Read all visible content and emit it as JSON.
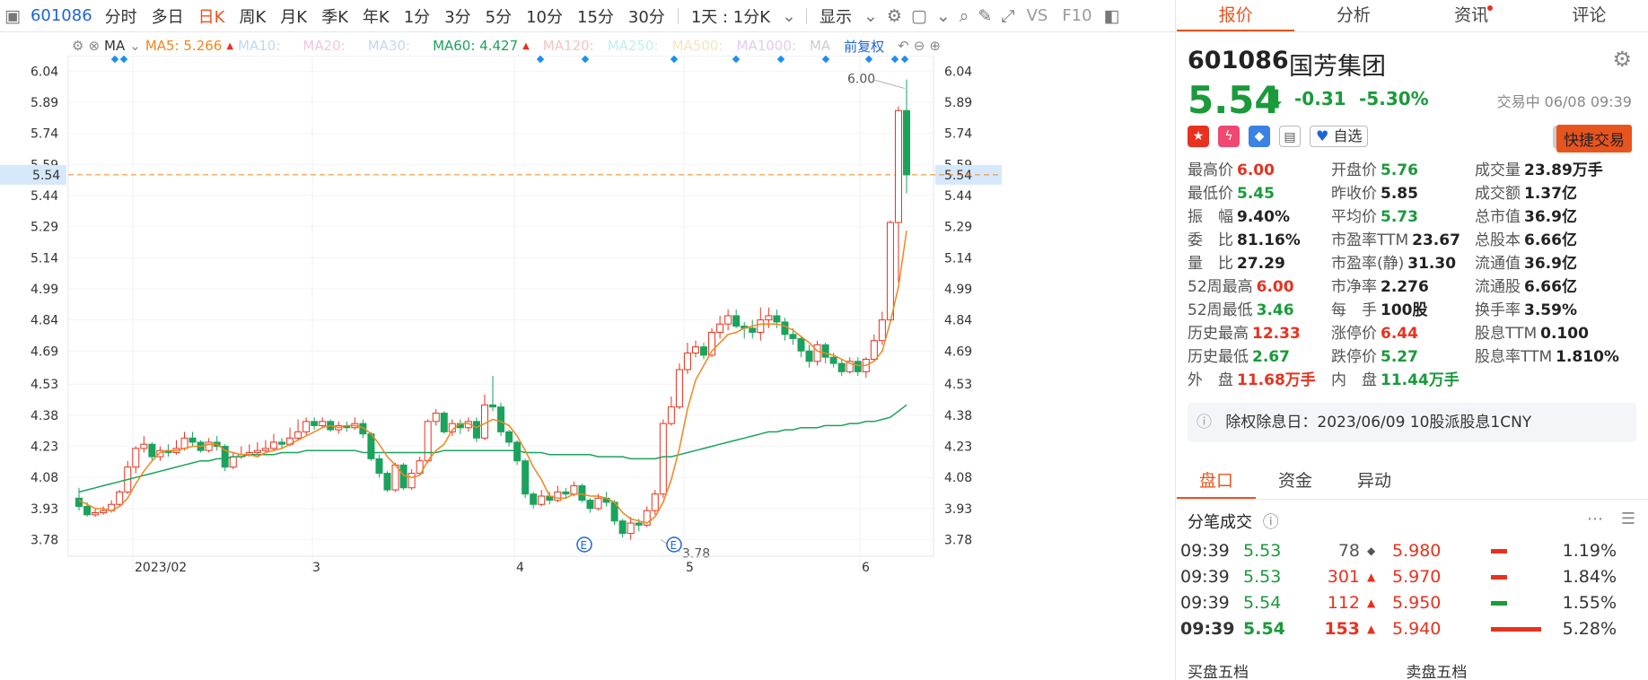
{
  "toolbar": {
    "code": "601086",
    "items": [
      "分时",
      "多日",
      "日K",
      "周K",
      "月K",
      "季K",
      "年K",
      "1分",
      "3分",
      "5分",
      "10分",
      "15分",
      "30分"
    ],
    "active": "日K",
    "range": "1天 : 1分K",
    "display": "显示",
    "vs": "VS",
    "f10": "F10"
  },
  "ma_bar": {
    "label": "MA",
    "ma5": "MA5: 5.266",
    "ma10": "MA10:",
    "ma20": "MA20:",
    "ma30": "MA30:",
    "ma60": "MA60: 4.427",
    "ma120": "MA120:",
    "ma250": "MA250:",
    "ma500": "MA500:",
    "ma1000": "MA1000:",
    "ma_more": "MA",
    "adjust": "前复权"
  },
  "chart_data": {
    "type": "candlestick",
    "y_ticks": [
      "6.04",
      "5.89",
      "5.74",
      "5.59",
      "5.44",
      "5.29",
      "5.14",
      "4.99",
      "4.84",
      "4.69",
      "4.53",
      "4.38",
      "4.23",
      "4.08",
      "3.93",
      "3.78"
    ],
    "current_price": "5.54",
    "x_labels": [
      "2023/02",
      "3",
      "4",
      "5",
      "6"
    ],
    "high_marker": "6.00",
    "low_marker": "3.78",
    "event_marker": "E",
    "candles": [
      [
        3.98,
        3.94,
        4.03,
        3.92
      ],
      [
        3.94,
        3.9,
        3.96,
        3.89
      ],
      [
        3.9,
        3.91,
        3.93,
        3.89
      ],
      [
        3.91,
        3.92,
        3.94,
        3.9
      ],
      [
        3.92,
        3.95,
        3.97,
        3.91
      ],
      [
        3.95,
        4.01,
        4.02,
        3.94
      ],
      [
        4.01,
        4.13,
        4.16,
        4.0
      ],
      [
        4.13,
        4.22,
        4.23,
        4.1
      ],
      [
        4.22,
        4.24,
        4.28,
        4.2
      ],
      [
        4.24,
        4.18,
        4.25,
        4.16
      ],
      [
        4.18,
        4.21,
        4.23,
        4.16
      ],
      [
        4.21,
        4.2,
        4.24,
        4.18
      ],
      [
        4.2,
        4.22,
        4.26,
        4.19
      ],
      [
        4.22,
        4.27,
        4.3,
        4.21
      ],
      [
        4.27,
        4.25,
        4.3,
        4.23
      ],
      [
        4.25,
        4.21,
        4.26,
        4.2
      ],
      [
        4.21,
        4.25,
        4.27,
        4.2
      ],
      [
        4.25,
        4.23,
        4.28,
        4.21
      ],
      [
        4.23,
        4.13,
        4.24,
        4.11
      ],
      [
        4.13,
        4.18,
        4.2,
        4.12
      ],
      [
        4.18,
        4.19,
        4.23,
        4.17
      ],
      [
        4.19,
        4.2,
        4.24,
        4.18
      ],
      [
        4.2,
        4.21,
        4.25,
        4.19
      ],
      [
        4.21,
        4.22,
        4.26,
        4.2
      ],
      [
        4.22,
        4.25,
        4.29,
        4.21
      ],
      [
        4.25,
        4.24,
        4.27,
        4.22
      ],
      [
        4.24,
        4.27,
        4.32,
        4.23
      ],
      [
        4.27,
        4.3,
        4.36,
        4.26
      ],
      [
        4.3,
        4.35,
        4.37,
        4.28
      ],
      [
        4.35,
        4.33,
        4.37,
        4.31
      ],
      [
        4.33,
        4.35,
        4.37,
        4.32
      ],
      [
        4.35,
        4.31,
        4.36,
        4.3
      ],
      [
        4.31,
        4.33,
        4.35,
        4.29
      ],
      [
        4.33,
        4.32,
        4.35,
        4.3
      ],
      [
        4.32,
        4.34,
        4.37,
        4.31
      ],
      [
        4.34,
        4.29,
        4.36,
        4.27
      ],
      [
        4.29,
        4.17,
        4.3,
        4.16
      ],
      [
        4.17,
        4.1,
        4.19,
        4.08
      ],
      [
        4.1,
        4.02,
        4.11,
        4.01
      ],
      [
        4.02,
        4.14,
        4.15,
        4.01
      ],
      [
        4.14,
        4.03,
        4.15,
        4.02
      ],
      [
        4.03,
        4.1,
        4.12,
        4.02
      ],
      [
        4.1,
        4.16,
        4.18,
        4.09
      ],
      [
        4.16,
        4.35,
        4.36,
        4.15
      ],
      [
        4.35,
        4.39,
        4.41,
        4.33
      ],
      [
        4.39,
        4.3,
        4.4,
        4.29
      ],
      [
        4.3,
        4.34,
        4.36,
        4.28
      ],
      [
        4.34,
        4.32,
        4.36,
        4.29
      ],
      [
        4.32,
        4.35,
        4.37,
        4.3
      ],
      [
        4.35,
        4.27,
        4.37,
        4.25
      ],
      [
        4.27,
        4.43,
        4.48,
        4.26
      ],
      [
        4.43,
        4.42,
        4.57,
        4.4
      ],
      [
        4.42,
        4.3,
        4.44,
        4.28
      ],
      [
        4.3,
        4.25,
        4.31,
        4.23
      ],
      [
        4.25,
        4.16,
        4.26,
        4.14
      ],
      [
        4.16,
        4.0,
        4.17,
        3.98
      ],
      [
        4.0,
        3.95,
        4.01,
        3.93
      ],
      [
        3.95,
        3.99,
        4.02,
        3.94
      ],
      [
        3.99,
        3.97,
        4.01,
        3.95
      ],
      [
        3.97,
        4.01,
        4.04,
        3.96
      ],
      [
        4.01,
        4.0,
        4.03,
        3.98
      ],
      [
        4.0,
        4.04,
        4.06,
        3.99
      ],
      [
        4.04,
        3.97,
        4.05,
        3.96
      ],
      [
        3.97,
        3.93,
        3.98,
        3.91
      ],
      [
        3.93,
        3.98,
        4.0,
        3.92
      ],
      [
        3.98,
        3.96,
        4.01,
        3.94
      ],
      [
        3.96,
        3.87,
        3.97,
        3.85
      ],
      [
        3.87,
        3.81,
        3.88,
        3.79
      ],
      [
        3.81,
        3.86,
        3.89,
        3.78
      ],
      [
        3.86,
        3.85,
        3.88,
        3.82
      ],
      [
        3.85,
        3.92,
        3.94,
        3.84
      ],
      [
        3.92,
        4.0,
        4.02,
        3.9
      ],
      [
        4.0,
        4.34,
        4.36,
        3.98
      ],
      [
        4.34,
        4.42,
        4.47,
        4.33
      ],
      [
        4.42,
        4.6,
        4.63,
        4.41
      ],
      [
        4.6,
        4.68,
        4.73,
        4.58
      ],
      [
        4.68,
        4.71,
        4.74,
        4.66
      ],
      [
        4.71,
        4.67,
        4.73,
        4.65
      ],
      [
        4.67,
        4.78,
        4.8,
        4.66
      ],
      [
        4.78,
        4.82,
        4.86,
        4.75
      ],
      [
        4.82,
        4.86,
        4.89,
        4.79
      ],
      [
        4.86,
        4.81,
        4.89,
        4.8
      ],
      [
        4.81,
        4.8,
        4.83,
        4.75
      ],
      [
        4.8,
        4.78,
        4.84,
        4.75
      ],
      [
        4.78,
        4.84,
        4.9,
        4.74
      ],
      [
        4.84,
        4.86,
        4.9,
        4.8
      ],
      [
        4.86,
        4.83,
        4.89,
        4.8
      ],
      [
        4.83,
        4.77,
        4.85,
        4.74
      ],
      [
        4.77,
        4.75,
        4.8,
        4.72
      ],
      [
        4.75,
        4.69,
        4.76,
        4.66
      ],
      [
        4.69,
        4.64,
        4.72,
        4.61
      ],
      [
        4.64,
        4.72,
        4.74,
        4.62
      ],
      [
        4.72,
        4.66,
        4.73,
        4.63
      ],
      [
        4.66,
        4.63,
        4.68,
        4.61
      ],
      [
        4.63,
        4.59,
        4.65,
        4.57
      ],
      [
        4.59,
        4.64,
        4.66,
        4.58
      ],
      [
        4.64,
        4.59,
        4.66,
        4.57
      ],
      [
        4.59,
        4.65,
        4.66,
        4.56
      ],
      [
        4.65,
        4.74,
        4.77,
        4.64
      ],
      [
        4.74,
        4.84,
        4.88,
        4.72
      ],
      [
        4.84,
        5.31,
        5.32,
        4.83
      ],
      [
        5.31,
        5.85,
        5.87,
        5.02
      ],
      [
        5.85,
        5.54,
        6.0,
        5.45
      ]
    ],
    "ma5": [
      3.97,
      3.95,
      3.93,
      3.93,
      3.92,
      3.94,
      3.98,
      4.05,
      4.11,
      4.16,
      4.2,
      4.21,
      4.21,
      4.22,
      4.23,
      4.23,
      4.24,
      4.24,
      4.21,
      4.2,
      4.19,
      4.19,
      4.18,
      4.2,
      4.21,
      4.22,
      4.24,
      4.26,
      4.28,
      4.3,
      4.32,
      4.33,
      4.32,
      4.33,
      4.33,
      4.32,
      4.29,
      4.24,
      4.18,
      4.14,
      4.09,
      4.08,
      4.09,
      4.16,
      4.21,
      4.24,
      4.31,
      4.34,
      4.34,
      4.32,
      4.34,
      4.36,
      4.35,
      4.33,
      4.28,
      4.21,
      4.13,
      4.07,
      3.99,
      3.98,
      3.98,
      4.0,
      4.0,
      3.99,
      3.99,
      3.98,
      3.96,
      3.91,
      3.88,
      3.87,
      3.86,
      3.89,
      3.96,
      4.07,
      4.22,
      4.41,
      4.55,
      4.62,
      4.69,
      4.73,
      4.77,
      4.78,
      4.8,
      4.81,
      4.82,
      4.82,
      4.82,
      4.81,
      4.79,
      4.76,
      4.73,
      4.69,
      4.68,
      4.67,
      4.65,
      4.63,
      4.62,
      4.62,
      4.64,
      4.69,
      4.83,
      5.0,
      5.27
    ],
    "ma60": [
      4.01,
      4.02,
      4.03,
      4.04,
      4.05,
      4.06,
      4.07,
      4.08,
      4.09,
      4.1,
      4.11,
      4.12,
      4.13,
      4.14,
      4.15,
      4.16,
      4.16,
      4.17,
      4.17,
      4.18,
      4.18,
      4.19,
      4.19,
      4.19,
      4.19,
      4.2,
      4.2,
      4.2,
      4.21,
      4.21,
      4.21,
      4.21,
      4.21,
      4.21,
      4.21,
      4.2,
      4.2,
      4.2,
      4.2,
      4.2,
      4.2,
      4.2,
      4.2,
      4.2,
      4.2,
      4.21,
      4.21,
      4.21,
      4.21,
      4.21,
      4.21,
      4.21,
      4.21,
      4.21,
      4.21,
      4.2,
      4.2,
      4.2,
      4.19,
      4.19,
      4.19,
      4.19,
      4.19,
      4.19,
      4.18,
      4.18,
      4.18,
      4.18,
      4.17,
      4.17,
      4.17,
      4.17,
      4.18,
      4.18,
      4.19,
      4.2,
      4.21,
      4.22,
      4.23,
      4.24,
      4.25,
      4.26,
      4.27,
      4.28,
      4.29,
      4.3,
      4.3,
      4.31,
      4.31,
      4.32,
      4.32,
      4.32,
      4.33,
      4.33,
      4.33,
      4.34,
      4.34,
      4.35,
      4.35,
      4.36,
      4.37,
      4.4,
      4.43
    ]
  },
  "stock": {
    "code": "601086",
    "name": "国芳集团",
    "price": "5.54",
    "change": "-0.31",
    "change_pct": "-5.30%",
    "status": "交易中 06/08 09:39",
    "zixuan": "自选",
    "quick_trade": "快捷交易"
  },
  "right_tabs": [
    "报价",
    "分析",
    "资讯",
    "评论"
  ],
  "quote_rows": [
    [
      [
        "最高价",
        "6.00",
        "red"
      ],
      [
        "开盘价",
        "5.76",
        "green"
      ],
      [
        "成交量",
        "23.89万手",
        "dark"
      ]
    ],
    [
      [
        "最低价",
        "5.45",
        "green"
      ],
      [
        "昨收价",
        "5.85",
        "dark"
      ],
      [
        "成交额",
        "1.37亿",
        "dark"
      ]
    ],
    [
      [
        "振　幅",
        "9.40%",
        "dark"
      ],
      [
        "平均价",
        "5.73",
        "green"
      ],
      [
        "总市值",
        "36.9亿",
        "dark"
      ]
    ],
    [
      [
        "委　比",
        "81.16%",
        "dark"
      ],
      [
        "市盈率TTM",
        "23.67",
        "dark"
      ],
      [
        "总股本",
        "6.66亿",
        "dark"
      ]
    ],
    [
      [
        "量　比",
        "27.29",
        "dark"
      ],
      [
        "市盈率(静)",
        "31.30",
        "dark"
      ],
      [
        "流通值",
        "36.9亿",
        "dark"
      ]
    ],
    [
      [
        "52周最高",
        "6.00",
        "red"
      ],
      [
        "市净率",
        "2.276",
        "dark"
      ],
      [
        "流通股",
        "6.66亿",
        "dark"
      ]
    ],
    [
      [
        "52周最低",
        "3.46",
        "green"
      ],
      [
        "每　手",
        "100股",
        "dark"
      ],
      [
        "换手率",
        "3.59%",
        "dark"
      ]
    ],
    [
      [
        "历史最高",
        "12.33",
        "red"
      ],
      [
        "涨停价",
        "6.44",
        "red"
      ],
      [
        "股息TTM",
        "0.100",
        "dark"
      ]
    ],
    [
      [
        "历史最低",
        "2.67",
        "green"
      ],
      [
        "跌停价",
        "5.27",
        "green"
      ],
      [
        "股息率TTM",
        "1.810%",
        "dark"
      ]
    ],
    [
      [
        "外　盘",
        "11.68万手",
        "red"
      ],
      [
        "内　盘",
        "11.44万手",
        "green"
      ]
    ]
  ],
  "notice": "除权除息日：2023/06/09  10股派股息1CNY",
  "lower_tabs": [
    "盘口",
    "资金",
    "异动"
  ],
  "trades_title": "分笔成交",
  "trades": [
    [
      "09:39",
      "5.53",
      "78",
      "gray"
    ],
    [
      "09:39",
      "5.53",
      "301",
      "red"
    ],
    [
      "09:39",
      "5.54",
      "112",
      "red"
    ],
    [
      "09:39",
      "5.54",
      "153",
      "red"
    ]
  ],
  "ladder": [
    [
      "5.980",
      "1.19%",
      "red"
    ],
    [
      "5.970",
      "1.84%",
      "red"
    ],
    [
      "5.950",
      "1.55%",
      "green"
    ],
    [
      "5.940",
      "5.28%",
      "red"
    ]
  ],
  "tail": [
    "买盘五档",
    "卖盘五档"
  ]
}
